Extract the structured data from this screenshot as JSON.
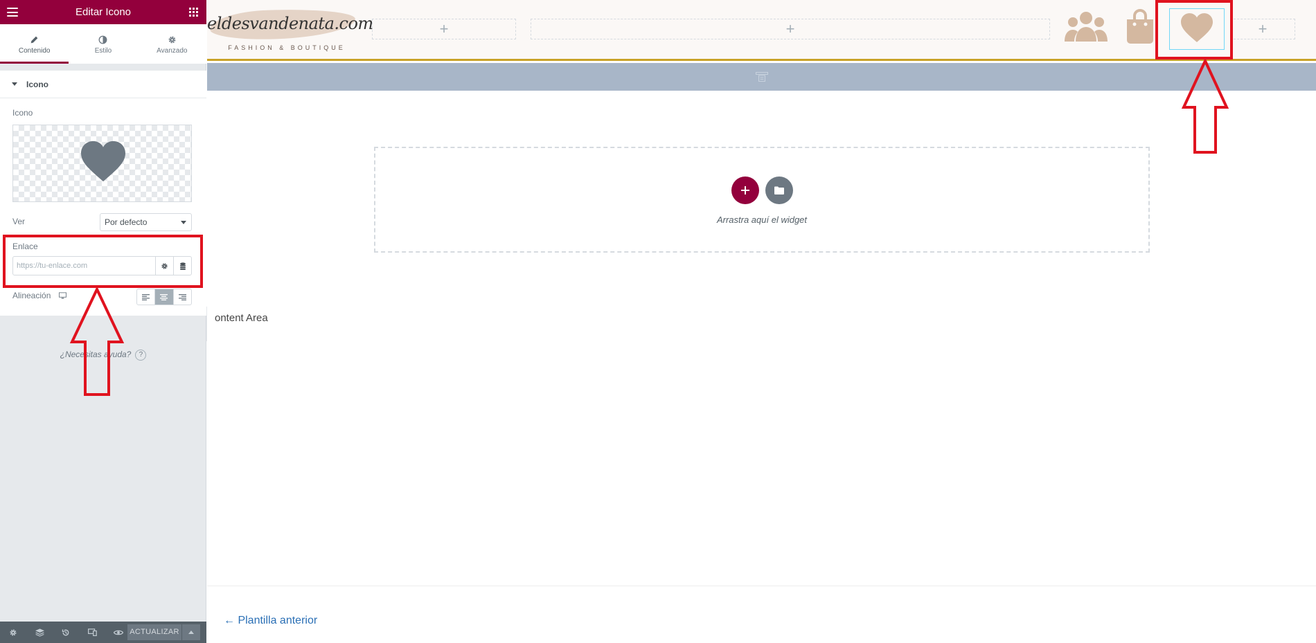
{
  "panel": {
    "title": "Editar Icono",
    "tabs": [
      {
        "label": "Contenido",
        "icon": "pencil-icon",
        "active": true
      },
      {
        "label": "Estilo",
        "icon": "half-circle-icon",
        "active": false
      },
      {
        "label": "Avanzado",
        "icon": "gear-icon",
        "active": false
      }
    ],
    "section_title": "Icono",
    "icon_label": "Icono",
    "view_label": "Ver",
    "view_value": "Por defecto",
    "link_label": "Enlace",
    "link_placeholder": "https://tu-enlace.com",
    "align_label": "Alineación",
    "align_selected": "center",
    "help_text": "¿Necesitas ayuda?",
    "help_icon": "?",
    "update_label": "ACTUALIZAR"
  },
  "canvas": {
    "logo_text": "eldesvandenata.com",
    "logo_tagline": "FASHION & BOUTIQUE",
    "drop_hint": "Arrastra aquí el widget",
    "content_area_label": "ontent Area",
    "prev_link": "← Plantilla anterior",
    "plus": "+"
  },
  "colors": {
    "brand": "#93003c",
    "header_icons": "#d4b8a0",
    "toolbar_strip": "#a8b6c8",
    "annotation_red": "#e0131f",
    "link": "#2a6fb5"
  }
}
